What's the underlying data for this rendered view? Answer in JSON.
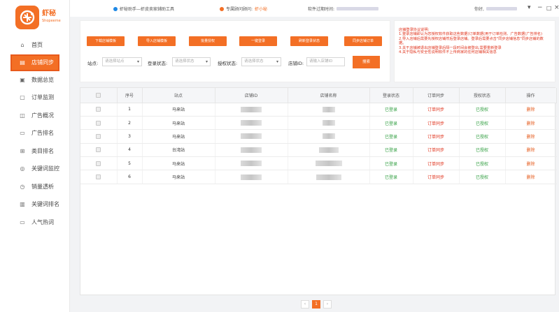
{
  "brand": {
    "name": "虾秘",
    "sub": "Shopeeme"
  },
  "nav": [
    {
      "label": "首页",
      "icon": "⌂"
    },
    {
      "label": "店铺同步",
      "icon": "▤"
    },
    {
      "label": "数据总览",
      "icon": "▣"
    },
    {
      "label": "订单监测",
      "icon": "▢"
    },
    {
      "label": "广告概况",
      "icon": "◫"
    },
    {
      "label": "广告排名",
      "icon": "▭"
    },
    {
      "label": "类目排名",
      "icon": "⊞"
    },
    {
      "label": "关键词监控",
      "icon": "◎"
    },
    {
      "label": "销量透析",
      "icon": "◷"
    },
    {
      "label": "关键词排名",
      "icon": "▥"
    },
    {
      "label": "人气热词",
      "icon": "▭"
    }
  ],
  "topbar": {
    "assistant": "虾秘助手—虾皮卖家辅助工具",
    "consultant_label": "专属顾问顾问:",
    "consultant_name": "虾小秘",
    "expiry_label": "软件过期时间:",
    "greeting": "你好,",
    "colors": {
      "accent": "#f36f25",
      "consultant_dot": "#f36f25",
      "assistant_dot": "#1e88e5"
    }
  },
  "toolbar": {
    "buttons": [
      "下载店铺模板",
      "导入店铺模板",
      "批量授权",
      "一键登录",
      "刷新登录状态",
      "同步店铺订单"
    ]
  },
  "filters": {
    "site_label": "站点:",
    "site_placeholder": "请选择站点",
    "login_label": "登录状态:",
    "login_placeholder": "请选择状态",
    "auth_label": "授权状态:",
    "auth_placeholder": "请选择状态",
    "shopid_label": "店铺ID:",
    "shopid_placeholder": "请输入店铺ID",
    "search_label": "搜索"
  },
  "notes": {
    "title": "店铺登录协议说明:",
    "lines": [
      "1.登录店铺即认为您授权软件获取这些数据(订单数据(用于订单检测、广告数据(广告排名)",
      "2.导入店铺后需要先授权店铺然后登录店铺。登录后需要点击\"同步店铺信息\"同步店铺的数据。",
      "3.关于店铺被退出店铺登录后隔一段时间会被登出,需要重新登录",
      "4.关于隐私与安全性说明软件不上传商家的任何店铺相关信息"
    ]
  },
  "table": {
    "headers": [
      "序号",
      "站点",
      "店铺ID",
      "店铺名称",
      "登录状态",
      "订单同步",
      "授权状态",
      "操作"
    ],
    "rows": [
      {
        "no": "1",
        "site": "马来站",
        "login": "已登录",
        "sync": "订单同步",
        "auth": "已授权",
        "op": "删除"
      },
      {
        "no": "2",
        "site": "马来站",
        "login": "已登录",
        "sync": "订单同步",
        "auth": "已授权",
        "op": "删除"
      },
      {
        "no": "3",
        "site": "马来站",
        "login": "已登录",
        "sync": "订单同步",
        "auth": "已授权",
        "op": "删除"
      },
      {
        "no": "4",
        "site": "台湾站",
        "login": "已登录",
        "sync": "订单同步",
        "auth": "已授权",
        "op": "删除"
      },
      {
        "no": "5",
        "site": "马来站",
        "login": "已登录",
        "sync": "订单同步",
        "auth": "已授权",
        "op": "删除"
      },
      {
        "no": "6",
        "site": "马来站",
        "login": "已登录",
        "sync": "订单同步",
        "auth": "已授权",
        "op": "删除"
      }
    ]
  },
  "pager": {
    "prev": "‹",
    "current": "1",
    "next": "›"
  }
}
